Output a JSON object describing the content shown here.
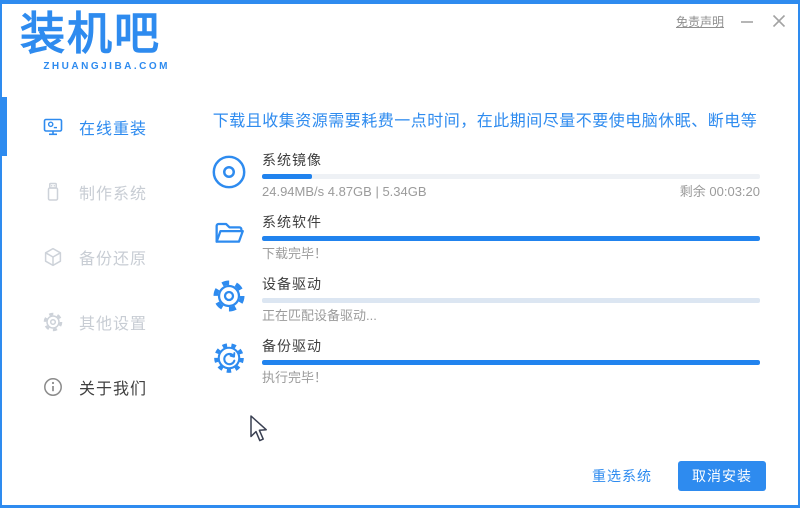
{
  "window": {
    "logo": {
      "text": "装机吧",
      "domain": "ZHUANGJIBA.COM"
    },
    "titlebar": {
      "disclaimer": "免责声明",
      "minimize_icon": "minimize",
      "close_icon": "close"
    }
  },
  "colors": {
    "accent": "#2e8bef",
    "progress_fill": "#2183ee",
    "progress_track": "#eef1f5",
    "progress_track_active": "#dce6f2",
    "title_text": "#3f3f3f",
    "secondary_text": "#9b9b9b",
    "sidebar_inactive": "#c8cdd4"
  },
  "sidebar": {
    "items": [
      {
        "label": "在线重装",
        "icon": "monitor-icon",
        "active": true
      },
      {
        "label": "制作系统",
        "icon": "usb-icon",
        "active": false
      },
      {
        "label": "备份还原",
        "icon": "cube-icon",
        "active": false
      },
      {
        "label": "其他设置",
        "icon": "gear-icon",
        "active": false
      },
      {
        "label": "关于我们",
        "icon": "info-icon",
        "active": false
      }
    ]
  },
  "main": {
    "notice": "下载且收集资源需要耗费一点时间，在此期间尽量不要使电脑休眠、断电等",
    "tasks": [
      {
        "title": "系统镜像",
        "icon": "disc-icon",
        "progress_percent": 10,
        "status": "24.94MB/s 4.87GB | 5.34GB",
        "remaining": "剩余 00:03:20"
      },
      {
        "title": "系统软件",
        "icon": "folder-icon",
        "progress_percent": 100,
        "status": "下载完毕！",
        "remaining": ""
      },
      {
        "title": "设备驱动",
        "icon": "gear-icon",
        "progress_percent": 0,
        "status": "正在匹配设备驱动...",
        "remaining": ""
      },
      {
        "title": "备份驱动",
        "icon": "gear-sync-icon",
        "progress_percent": 100,
        "status": "执行完毕！",
        "remaining": ""
      }
    ]
  },
  "footer": {
    "reselect_label": "重选系统",
    "cancel_label": "取消安装"
  }
}
